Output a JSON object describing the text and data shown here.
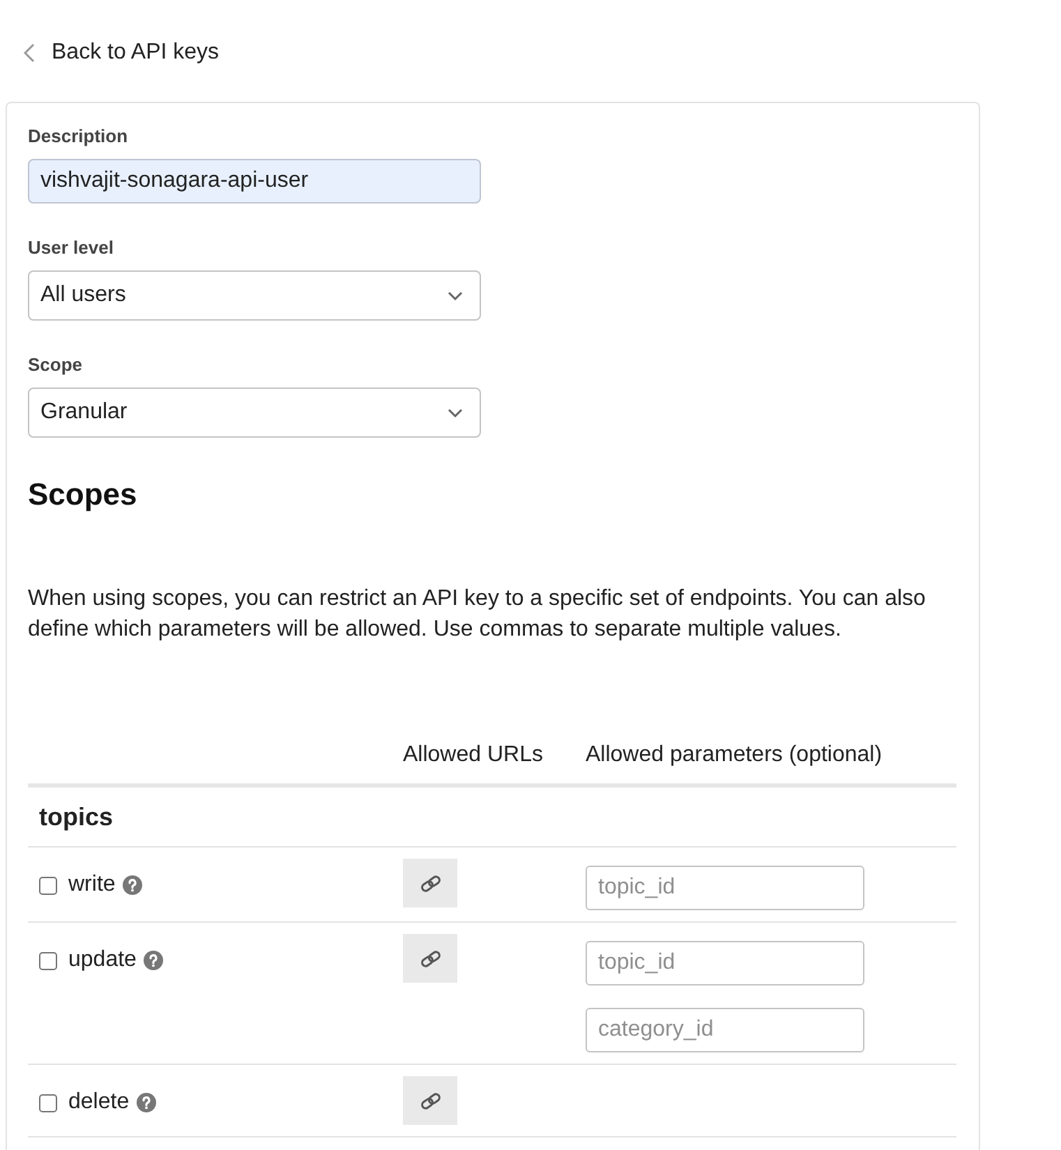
{
  "back_link": {
    "label": "Back to API keys"
  },
  "fields": [
    {
      "kind": "text",
      "label": "Description",
      "value": "vishvajit-sonagara-api-user",
      "autofilled": true
    },
    {
      "kind": "select",
      "label": "User level",
      "value": "All users"
    },
    {
      "kind": "select",
      "label": "Scope",
      "value": "Granular"
    }
  ],
  "scopes": {
    "title": "Scopes",
    "description": "When using scopes, you can restrict an API key to a specific set of endpoints. You can also define which parameters will be allowed. Use commas to separate multiple values.",
    "columns": [
      "Allowed URLs",
      "Allowed parameters (optional)"
    ],
    "groups": [
      {
        "name": "topics",
        "rows": [
          {
            "action": "write",
            "checked": false,
            "parameters": [
              {
                "placeholder": "topic_id"
              }
            ]
          },
          {
            "action": "update",
            "checked": false,
            "parameters": [
              {
                "placeholder": "topic_id"
              },
              {
                "placeholder": "category_id"
              }
            ]
          },
          {
            "action": "delete",
            "checked": false
          }
        ]
      }
    ]
  }
}
